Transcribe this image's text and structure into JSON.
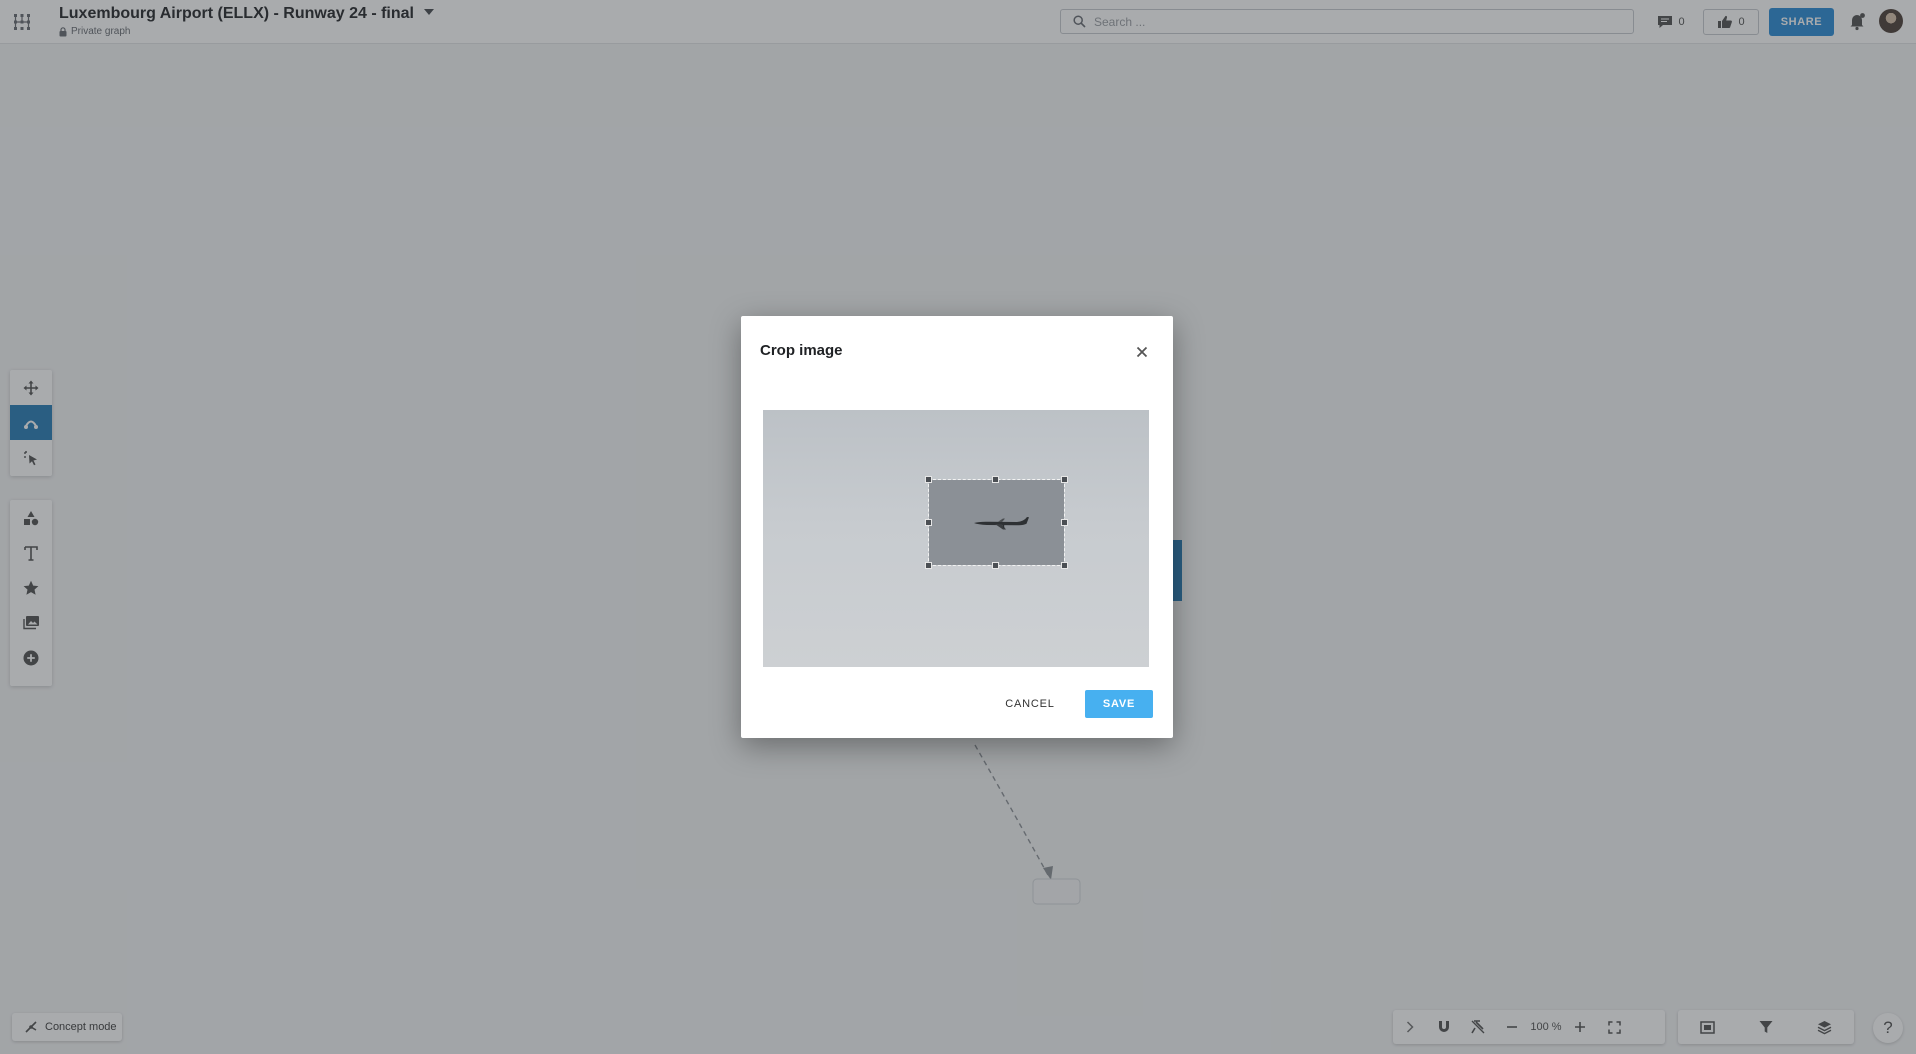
{
  "header": {
    "title": "Luxembourg Airport (ELLX) - Runway 24 - final",
    "privacy": "Private graph",
    "search_placeholder": "Search ...",
    "comments_count": "0",
    "likes_count": "0",
    "share_label": "SHARE"
  },
  "toolbar": {
    "tools": [
      "move-tool",
      "connect-tool",
      "select-tool",
      "shapes-tool",
      "text-tool",
      "star-tool",
      "image-tool",
      "add-tool"
    ],
    "active_tool": "connect-tool"
  },
  "footer": {
    "concept_mode_label": "Concept mode",
    "zoom_level": "100 %",
    "help_label": "?"
  },
  "modal": {
    "title": "Crop image",
    "cancel_label": "CANCEL",
    "save_label": "SAVE"
  },
  "colors": {
    "accent": "#2c7fb8",
    "share": "#2f8ed8",
    "save": "#47b0f0"
  }
}
